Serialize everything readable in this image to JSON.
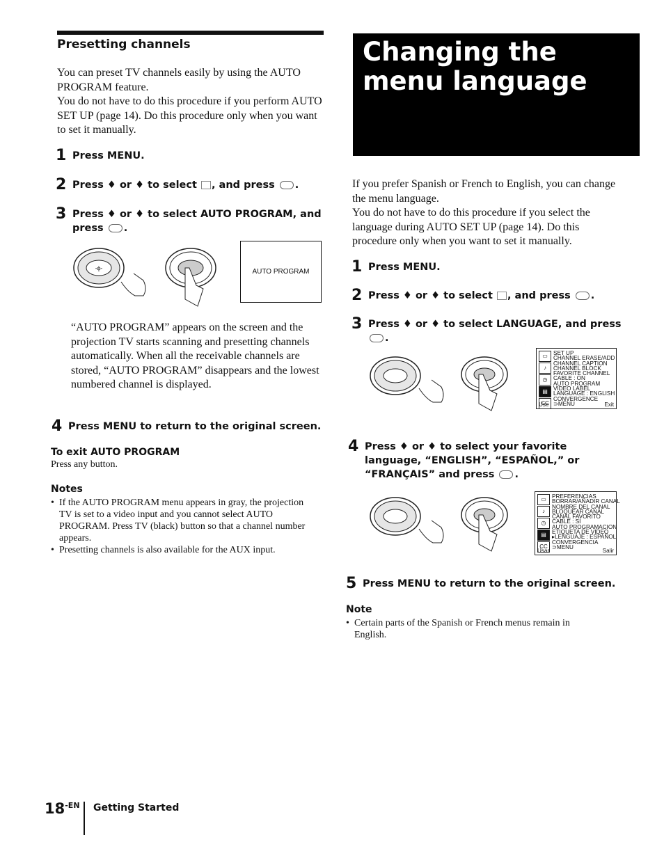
{
  "left": {
    "section_title": "Presetting channels",
    "intro_1": "You can preset TV channels easily by using the AUTO PROGRAM feature.",
    "intro_2": "You do not have to do this procedure if you perform AUTO SET UP (page 14). Do this procedure only when you want to set it manually.",
    "steps": [
      {
        "num": "1",
        "text": "Press MENU."
      },
      {
        "num": "2",
        "text_a": "Press ♦ or ♦ to select",
        "text_b": ", and press",
        "text_c": "."
      },
      {
        "num": "3",
        "text_a": "Press ♦ or ♦ to select AUTO PROGRAM, and",
        "text_b": "press",
        "text_c": "."
      },
      {
        "num": "4",
        "text": "Press MENU to return to the original screen."
      }
    ],
    "screen_label": "AUTO PROGRAM",
    "description": "“AUTO PROGRAM” appears on the screen and the projection TV starts scanning and presetting channels automatically. When all the receivable channels are stored, “AUTO PROGRAM” disappears and the lowest numbered channel is displayed.",
    "exit_heading": "To exit AUTO PROGRAM",
    "exit_text": "Press any button.",
    "notes_heading": "Notes",
    "notes": [
      "If the AUTO PROGRAM menu appears in gray, the projection TV is set to a video input and you cannot select AUTO PROGRAM. Press TV (black) button so that a channel number appears.",
      "Presetting channels is also available for the AUX input."
    ]
  },
  "right": {
    "hero_title_line1": "Changing the",
    "hero_title_line2": "menu language",
    "intro_1": "If you prefer Spanish or French to English, you can change the menu language.",
    "intro_2": "You do not have to do this procedure if you select the language during AUTO SET UP (page 14).  Do this procedure only when you want to set it manually.",
    "steps": [
      {
        "num": "1",
        "text": "Press MENU."
      },
      {
        "num": "2",
        "text_a": "Press ♦ or ♦ to select",
        "text_b": ", and press",
        "text_c": "."
      },
      {
        "num": "3",
        "text_a": "Press ♦ or ♦ to select LANGUAGE, and press",
        "text_c": "."
      },
      {
        "num": "4",
        "text_a": "Press ♦ or ♦ to select your favorite",
        "text_b": "language, “ENGLISH”, “ESPAÑOL,” or",
        "text_c": "“FRANÇAIS” and press",
        "text_d": "."
      },
      {
        "num": "5",
        "text": "Press MENU to return to the original screen."
      }
    ],
    "menu_en": {
      "lines": [
        "SET UP",
        " CHANNEL ERASE/ADD",
        " CHANNEL CAPTION",
        " CHANNEL BLOCK",
        " FAVORITE CHANNEL",
        " CABLE : ON",
        " AUTO PROGRAM",
        " VIDEO LABEL",
        " LANGUAGE : ENGLISH",
        " CONVERGENCE",
        " ⊃MENU"
      ],
      "use_label": "Use",
      "exit_label": "Exit"
    },
    "menu_es": {
      "lines": [
        "PREFERENCIAS",
        " BORRAR/AÑADIR CANAL",
        " NOMBRE DEL CANAL",
        " BLOQUEAR CANAL",
        " CANAL FAVORITO",
        " CABLE : SI",
        " AUTO PROGRAMACION",
        " ETIQUETA DE VIDEO",
        "▸LENGUAJE : ESPAÑOL",
        " CONVERGENCIA",
        " ⊃MENU"
      ],
      "use_label": "Usar",
      "exit_label": "Salir"
    },
    "note_heading": "Note",
    "note": "Certain parts of the Spanish or French menus remain in English."
  },
  "footer": {
    "page_num": "18",
    "page_suffix": "-EN",
    "section": "Getting Started"
  }
}
